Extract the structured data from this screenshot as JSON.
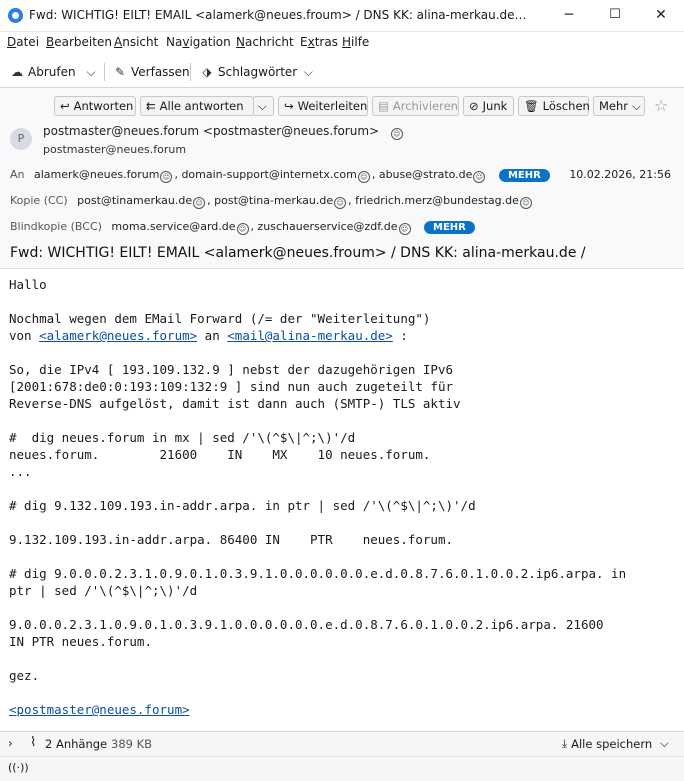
{
  "window": {
    "title": "Fwd: WICHTIG! EILT! EMAIL <alamerk@neues.froum> / DNS KK: alina-merkau.de / alinamerkau.de / alina-merkau.de / alinamerkau.de",
    "minimize": "─",
    "maximize": "☐",
    "close": "✕"
  },
  "menu": {
    "datei": {
      "accel": "D",
      "rest": "atei"
    },
    "bearbeiten": {
      "accel": "B",
      "rest": "earbeiten"
    },
    "ansicht": {
      "accel": "A",
      "rest": "nsicht"
    },
    "navigation_pre": "Na",
    "navigation_accel": "v",
    "navigation_rest": "igation",
    "nachricht": {
      "accel": "N",
      "rest": "achricht"
    },
    "extras_pre": "E",
    "extras_accel": "x",
    "extras_rest": "tras",
    "hilfe": {
      "accel": "H",
      "rest": "ilfe"
    }
  },
  "toolbar": {
    "abrufen": "Abrufen",
    "verfassen": "Verfassen",
    "schlagwoerter": "Schlagwörter"
  },
  "header_buttons": {
    "antworten": "Antworten",
    "antworten_alle": "Alle antworten",
    "weiterleiten": "Weiterleiten",
    "archivieren": "Archivieren",
    "junk": "Junk",
    "loeschen": "Löschen",
    "mehr": "Mehr"
  },
  "from": {
    "avatar_letter": "P",
    "main": "postmaster@neues.forum <postmaster@neues.forum>",
    "sub": "postmaster@neues.forum"
  },
  "to": {
    "label": "An",
    "r1": "alamerk@neues.forum",
    "r2": "domain-support@internetx.com",
    "r3": "abuse@strato.de",
    "mehr": "MEHR",
    "date": "10.02.2026, 21:56"
  },
  "cc": {
    "label": "Kopie (CC)",
    "r1": "post@tinamerkau.de",
    "r2": "post@tina-merkau.de",
    "r3": "friedrich.merz@bundestag.de"
  },
  "bcc": {
    "label": "Blindkopie (BCC)",
    "r1": "moma.service@ard.de",
    "r2": "zuschauerservice@zdf.de",
    "mehr": "MEHR"
  },
  "subject": "Fwd: WICHTIG! EILT! EMAIL <alamerk@neues.froum> / DNS KK: alina-merkau.de /",
  "body": {
    "l1": "Hallo",
    "l2": "Nochmal wegen dem EMail Forward (/= der \"Weiterleitung\")",
    "l3_pre": "von ",
    "l3_link1": "<alamerk@neues.forum>",
    "l3_mid": " an ",
    "l3_link2": "<mail@alina-merkau.de>",
    "l3_post": " :",
    "l4": "So, die IPv4 [ 193.109.132.9 ] nebst der dazugehörigen IPv6",
    "l5": "[2001:678:de0:0:193:109:132:9 ] sind nun auch zugeteilt für",
    "l6": "Reverse-DNS aufgelöst, damit ist dann auch (SMTP-) TLS aktiv",
    "l7": "#  dig neues.forum in mx | sed /'\\(^$\\|^;\\)'/d",
    "l8": "neues.forum.        21600    IN    MX    10 neues.forum.",
    "l9": "...",
    "l10": "# dig 9.132.109.193.in-addr.arpa. in ptr | sed /'\\(^$\\|^;\\)'/d",
    "l11": "9.132.109.193.in-addr.arpa. 86400 IN    PTR    neues.forum.",
    "l12": "# dig 9.0.0.0.2.3.1.0.9.0.1.0.3.9.1.0.0.0.0.0.0.e.d.0.8.7.6.0.1.0.0.2.ip6.arpa. in",
    "l13": "ptr | sed /'\\(^$\\|^;\\)'/d",
    "l14": "9.0.0.0.2.3.1.0.9.0.1.0.3.9.1.0.0.0.0.0.0.e.d.0.8.7.6.0.1.0.0.2.ip6.arpa. 21600",
    "l15": "IN PTR neues.forum.",
    "l16": "gez.",
    "l17_link": "<postmaster@neues.forum>"
  },
  "attachments": {
    "count_label": "2 Anhänge",
    "size": "389 KB",
    "save_all": "Alle speichern"
  },
  "colors": {
    "accent": "#0b72c9",
    "link": "#0b4ea2"
  }
}
